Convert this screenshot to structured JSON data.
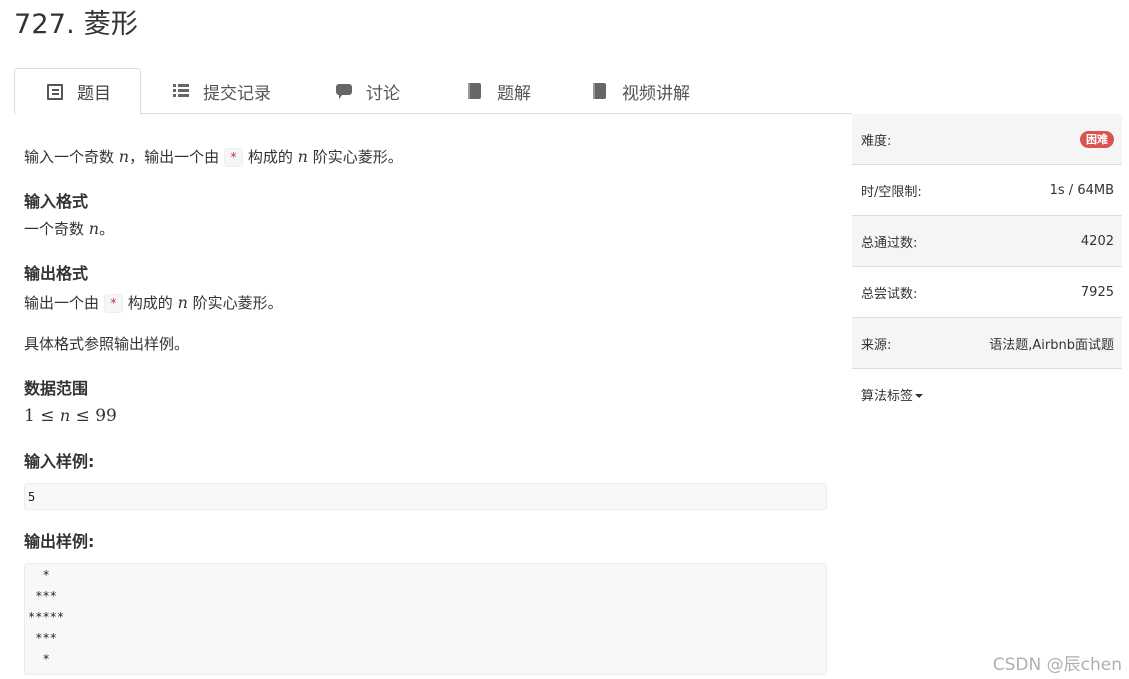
{
  "problem": {
    "title": "727. 菱形"
  },
  "tabs": [
    {
      "label": "题目",
      "icon": "document-icon",
      "active": true
    },
    {
      "label": "提交记录",
      "icon": "list-icon"
    },
    {
      "label": "讨论",
      "icon": "comment-icon"
    },
    {
      "label": "题解",
      "icon": "book-icon"
    },
    {
      "label": "视频讲解",
      "icon": "book-icon"
    }
  ],
  "statement": {
    "p1": {
      "a": "输入一个奇数 ",
      "var": "n",
      "b": "，输出一个由 ",
      "code": "*",
      "c": " 构成的 ",
      "var2": "n",
      "d": " 阶实心菱形。"
    },
    "input_heading": "输入格式",
    "input_text": {
      "a": "一个奇数 ",
      "var": "n",
      "b": "。"
    },
    "output_heading": "输出格式",
    "output_text": {
      "a": "输出一个由 ",
      "code": "*",
      "b": " 构成的 ",
      "var": "n",
      "c": " 阶实心菱形。"
    },
    "output_note": "具体格式参照输出样例。",
    "range_heading": "数据范围",
    "range": {
      "a": "1 ≤ ",
      "var": "n",
      "b": " ≤ 99"
    },
    "sample_input_heading": "输入样例:",
    "sample_input": "5",
    "sample_output_heading": "输出样例:",
    "sample_output": "  *\n ***\n*****\n ***\n  *"
  },
  "sidebar": {
    "difficulty_label": "难度:",
    "difficulty_value": "困难",
    "difficulty_color": "#d9534f",
    "limit_label": "时/空限制:",
    "limit_value": "1s / 64MB",
    "passed_label": "总通过数:",
    "passed_value": "4202",
    "tried_label": "总尝试数:",
    "tried_value": "7925",
    "source_label": "来源:",
    "source_value": "语法题,Airbnb面试题",
    "tags_label": "算法标签"
  },
  "watermark": "CSDN @辰chen"
}
